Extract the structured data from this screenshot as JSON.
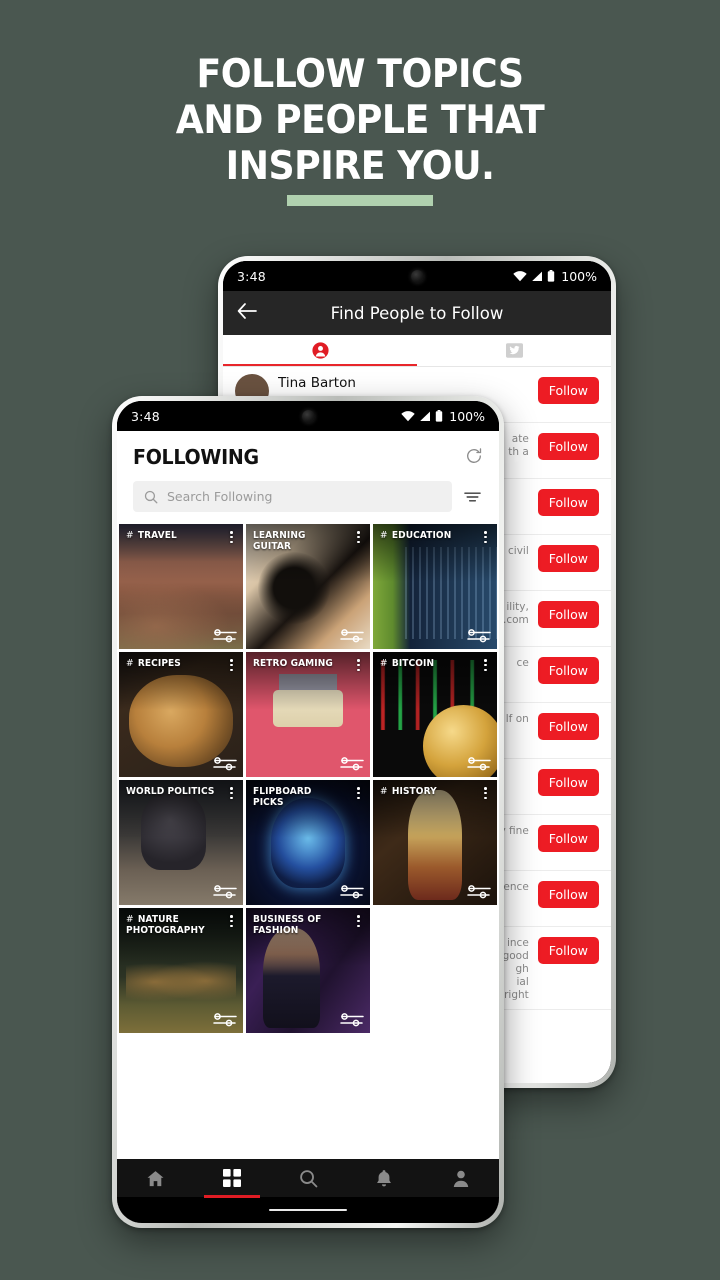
{
  "background_color": "#4a5750",
  "accent_green": "#b0d1af",
  "brand_red": "#ed1c24",
  "headline": {
    "line1": "FOLLOW TOPICS",
    "line2": "AND PEOPLE THAT",
    "line3": "INSPIRE YOU."
  },
  "back_phone": {
    "status": {
      "time": "3:48",
      "battery": "100%"
    },
    "appbar": {
      "back_icon": "back-arrow-icon",
      "title": "Find People to Follow"
    },
    "tabs": [
      {
        "icon": "person-icon",
        "active": true
      },
      {
        "icon": "twitter-bird-icon",
        "active": false
      }
    ],
    "people": [
      {
        "name": "Tina Barton",
        "bio": "",
        "follow_label": "Follow"
      },
      {
        "name": "",
        "bio": "ate\nth a",
        "follow_label": "Follow"
      },
      {
        "name": "",
        "bio": "",
        "follow_label": "Follow"
      },
      {
        "name": "",
        "bio": "and civil",
        "follow_label": "Follow"
      },
      {
        "name": "",
        "bio": "ility,\nn.com",
        "follow_label": "Follow"
      },
      {
        "name": "",
        "bio": "ce",
        "follow_label": "Follow"
      },
      {
        "name": "",
        "bio": "lf on",
        "follow_label": "Follow"
      },
      {
        "name": "",
        "bio": "",
        "follow_label": "Follow"
      },
      {
        "name": "",
        "bio": "y fine",
        "follow_label": "Follow"
      },
      {
        "name": "",
        "bio": "ience",
        "follow_label": "Follow"
      },
      {
        "name": "",
        "bio": "ince\ngood\ngh\nial\ne right",
        "follow_label": "Follow"
      }
    ]
  },
  "front_phone": {
    "status": {
      "time": "3:48",
      "battery": "100%"
    },
    "header": {
      "title": "FOLLOWING",
      "refresh_icon": "refresh-icon"
    },
    "search": {
      "placeholder": "Search Following",
      "value": "",
      "search_icon": "search-icon",
      "filter_icon": "filter-icon"
    },
    "tiles": [
      {
        "label": "TRAVEL",
        "hash": true,
        "art": "art-travel"
      },
      {
        "label": "LEARNING GUITAR",
        "hash": false,
        "art": "art-guitar"
      },
      {
        "label": "EDUCATION",
        "hash": true,
        "art": "art-education"
      },
      {
        "label": "RECIPES",
        "hash": true,
        "art": "art-recipes"
      },
      {
        "label": "RETRO GAMING",
        "hash": false,
        "art": "art-retro"
      },
      {
        "label": "BITCOIN",
        "hash": true,
        "art": "art-bitcoin"
      },
      {
        "label": "WORLD POLITICS",
        "hash": false,
        "art": "art-politics"
      },
      {
        "label": "FLIPBOARD PICKS",
        "hash": false,
        "art": "art-flipboard"
      },
      {
        "label": "HISTORY",
        "hash": true,
        "art": "art-history"
      },
      {
        "label": "NATURE PHOTOGRAPHY",
        "hash": true,
        "art": "art-nature"
      },
      {
        "label": "BUSINESS OF FASHION",
        "hash": false,
        "art": "art-fashion"
      }
    ],
    "bottom_nav": [
      {
        "icon": "home-icon",
        "active": false
      },
      {
        "icon": "grid-icon",
        "active": true
      },
      {
        "icon": "search-icon",
        "active": false
      },
      {
        "icon": "bell-icon",
        "active": false
      },
      {
        "icon": "profile-icon",
        "active": false
      }
    ]
  }
}
